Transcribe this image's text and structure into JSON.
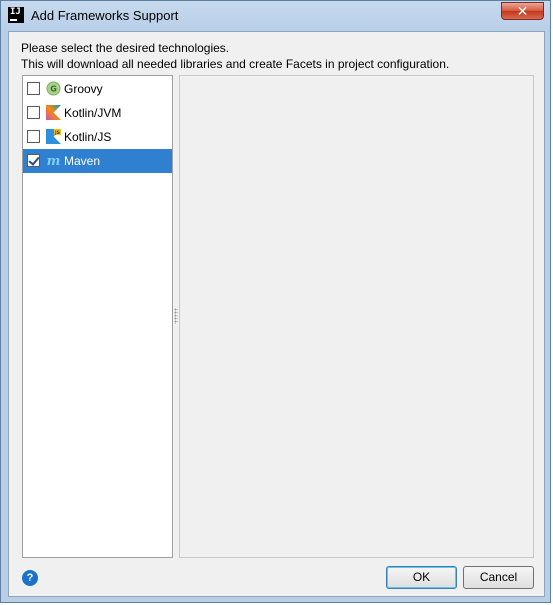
{
  "window": {
    "title": "Add Frameworks Support",
    "app_icon_text": "IJ",
    "close_glyph": "✕"
  },
  "description": {
    "line1": "Please select the desired technologies.",
    "line2": "This will download all needed libraries and create Facets in project configuration."
  },
  "frameworks": [
    {
      "label": "Groovy",
      "icon": "groovy-icon",
      "checked": false,
      "selected": false
    },
    {
      "label": "Kotlin/JVM",
      "icon": "kotlin-icon",
      "checked": false,
      "selected": false
    },
    {
      "label": "Kotlin/JS",
      "icon": "kotlin-js-icon",
      "checked": false,
      "selected": false
    },
    {
      "label": "Maven",
      "icon": "maven-icon",
      "checked": true,
      "selected": true
    }
  ],
  "buttons": {
    "help": "?",
    "ok": "OK",
    "cancel": "Cancel"
  },
  "colors": {
    "selection": "#2f80d1",
    "titlebar": "#b9cfe8"
  }
}
